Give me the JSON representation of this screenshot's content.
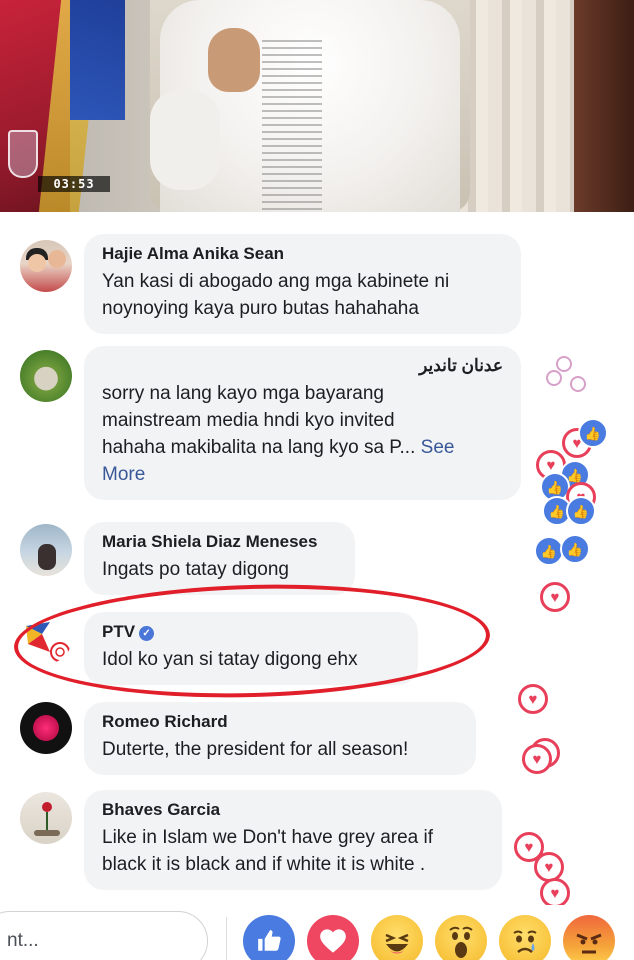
{
  "video": {
    "timestamp": "03:53"
  },
  "comments": [
    {
      "name": "Hajie Alma Anika Sean",
      "text_lines": [
        "Yan kasi di abogado ang mga kabinete ni",
        "noynoying kaya puro butas hahahaha"
      ]
    },
    {
      "name": "عدنان تاندير",
      "text_lines": [
        "sorry na lang kayo mga bayarang",
        "mainstream media hndi kyo invited",
        "hahaha makibalita na lang kyo sa P..."
      ],
      "see_more_a": "See",
      "see_more_b": "More"
    },
    {
      "name": "Maria Shiela Diaz Meneses",
      "text_lines": [
        "Ingats po tatay digong"
      ]
    },
    {
      "name": "PTV",
      "verified": true,
      "text_lines": [
        "Idol ko yan si tatay digong ehx"
      ]
    },
    {
      "name": "Romeo Richard",
      "text_lines": [
        "Duterte, the president for all season!"
      ]
    },
    {
      "name": "Bhaves Garcia",
      "text_lines": [
        "Like in Islam we Don't have grey area if",
        "black it is black and if white it is white ."
      ]
    }
  ],
  "icons": {
    "like": "thumbs-up-icon",
    "love": "heart-icon",
    "haha": "laughing-face-icon",
    "wow": "surprised-face-icon",
    "sad": "sad-face-icon",
    "angry": "angry-face-icon",
    "verified": "verified-badge-icon"
  },
  "colors": {
    "annotation_circle": "#e11f2a",
    "like_blue": "#4a7be0",
    "love_red": "#ef4661",
    "bubble_bg": "#f2f3f5",
    "link": "#385898"
  },
  "bottom_bar": {
    "input_text": "nt..."
  }
}
